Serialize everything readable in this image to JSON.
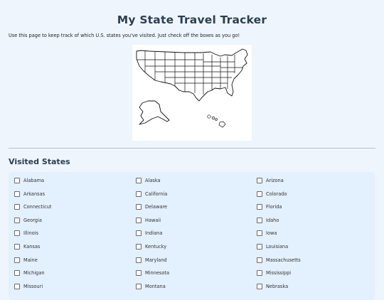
{
  "header": {
    "title": "My State Travel Tracker",
    "intro": "Use this page to keep track of which U.S. states you've visited. Just check off the boxes as you go!"
  },
  "map": {
    "icon": "us-states-map"
  },
  "visited": {
    "heading": "Visited States",
    "states": [
      {
        "name": "Alabama",
        "checked": false
      },
      {
        "name": "Alaska",
        "checked": false
      },
      {
        "name": "Arizona",
        "checked": false
      },
      {
        "name": "Arkansas",
        "checked": false
      },
      {
        "name": "California",
        "checked": false
      },
      {
        "name": "Colorado",
        "checked": false
      },
      {
        "name": "Connecticut",
        "checked": false
      },
      {
        "name": "Delaware",
        "checked": false
      },
      {
        "name": "Florida",
        "checked": false
      },
      {
        "name": "Georgia",
        "checked": false
      },
      {
        "name": "Hawaii",
        "checked": false
      },
      {
        "name": "Idaho",
        "checked": false
      },
      {
        "name": "Illinois",
        "checked": false
      },
      {
        "name": "Indiana",
        "checked": false
      },
      {
        "name": "Iowa",
        "checked": false
      },
      {
        "name": "Kansas",
        "checked": false
      },
      {
        "name": "Kentucky",
        "checked": false
      },
      {
        "name": "Louisiana",
        "checked": false
      },
      {
        "name": "Maine",
        "checked": false
      },
      {
        "name": "Maryland",
        "checked": false
      },
      {
        "name": "Massachusetts",
        "checked": false
      },
      {
        "name": "Michigan",
        "checked": false
      },
      {
        "name": "Minnesota",
        "checked": false
      },
      {
        "name": "Mississippi",
        "checked": false
      },
      {
        "name": "Missouri",
        "checked": false
      },
      {
        "name": "Montana",
        "checked": false
      },
      {
        "name": "Nebraska",
        "checked": false
      }
    ]
  }
}
